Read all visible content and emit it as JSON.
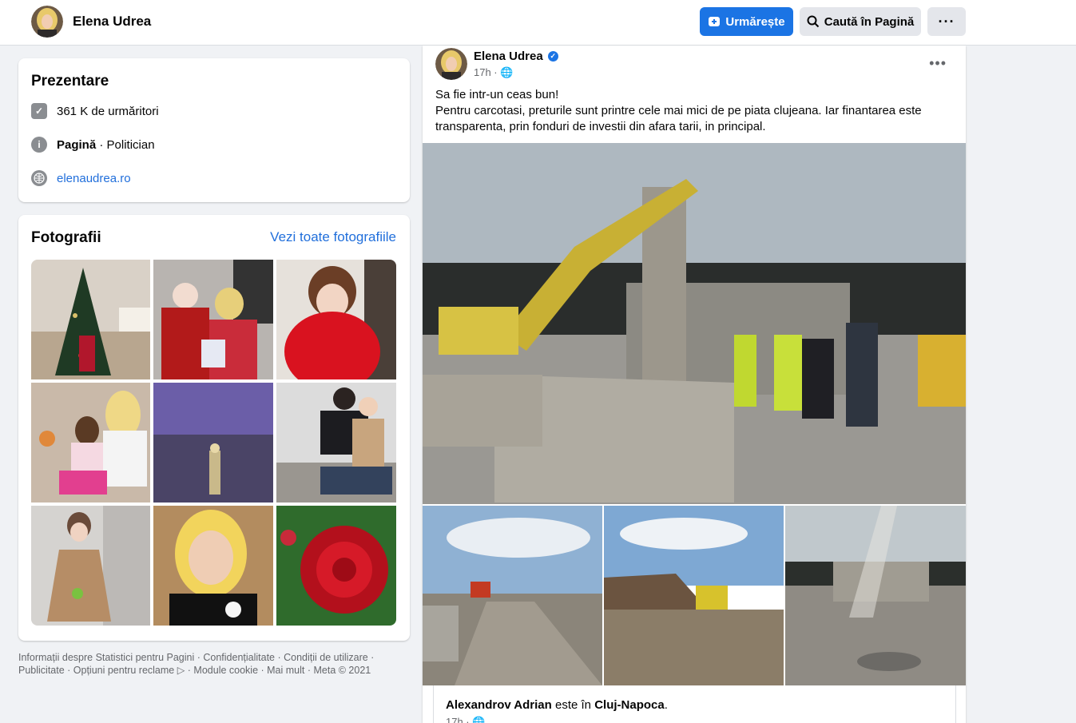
{
  "header": {
    "page_name": "Elena Udrea",
    "follow_label": "Urmărește",
    "search_label": "Caută în Pagină",
    "more_label": "···"
  },
  "intro": {
    "title": "Prezentare",
    "followers_count": "361 K",
    "followers_label": " de urmăritori",
    "category_prefix": "Pagină",
    "category_value": " · Politician",
    "website": "elenaudrea.ro"
  },
  "photos": {
    "title": "Fotografii",
    "see_all": "Vezi toate fotografiile"
  },
  "footer": {
    "line1": "Informații despre Statistici pentru Pagini · Confidențialitate · Condiții de utilizare ·",
    "line2": "Publicitate · Opțiuni pentru reclame ▷ · Module cookie · Mai mult · Meta © 2021"
  },
  "post": {
    "author": "Elena Udrea",
    "time": "17h · 🌐",
    "text_line1": "Sa fie intr-un ceas bun!",
    "text_line2": "Pentru carcotasi, preturile sunt printre cele mai mici de pe piata clujeana. Iar finantarea este transparenta, prin fonduri de investii din afara tarii, in principal.",
    "shared_name": "Alexandrov Adrian",
    "shared_mid": " este în ",
    "shared_place": "Cluj-Napoca",
    "shared_end": ".",
    "shared_time": "17h · 🌐"
  },
  "colors": {
    "accent": "#1b74e4",
    "link": "#216fdb",
    "background": "#f0f2f5"
  }
}
